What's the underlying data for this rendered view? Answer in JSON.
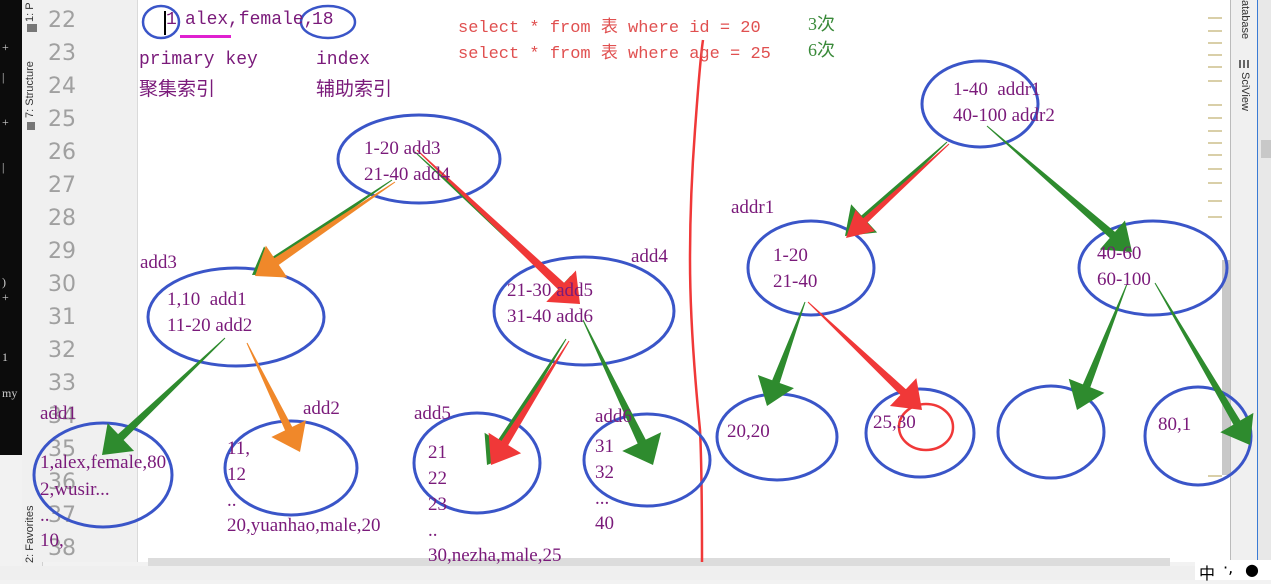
{
  "terminal": {
    "lines": [
      "+",
      "|",
      "+",
      "|",
      ")",
      "+",
      "1",
      "my"
    ]
  },
  "left_toolwindows": {
    "project": "1: P",
    "structure": "7: Structure",
    "favorites": "2: Favorites"
  },
  "right_toolwindows": {
    "database": "atabase",
    "sciview": "SciView"
  },
  "line_numbers": [
    "22",
    "23",
    "24",
    "25",
    "26",
    "27",
    "28",
    "29",
    "30",
    "31",
    "32",
    "33",
    "34",
    "35",
    "36",
    "37",
    "38"
  ],
  "editor": {
    "row_record": {
      "id": "1",
      "name": "alex",
      "rest": ",female,",
      "age": "18"
    },
    "labels": {
      "primary_key": "primary key",
      "clustered_index": "聚集索引",
      "index": "index",
      "secondary_index": "辅助索引"
    },
    "queries": [
      {
        "sql": "select * from 表 where id = 20",
        "count": "3次"
      },
      {
        "sql": "select * from 表 where age = 25",
        "count": "6次"
      }
    ]
  },
  "clustered_tree": {
    "root": {
      "line1": "1-20 add3",
      "line2": "21-40 add4"
    },
    "add3_label": "add3",
    "add3": {
      "line1": "1,10  add1",
      "line2": "11-20 add2"
    },
    "add4_label": "add4",
    "add4": {
      "line1": "21-30 add5",
      "line2": "31-40 add6"
    },
    "leaves": {
      "add1": {
        "label": "add1",
        "rows": [
          "1,alex,female,80",
          "2,wusir...",
          "..",
          "10,"
        ]
      },
      "add2": {
        "label": "add2",
        "rows": [
          "11,",
          "12",
          "..",
          "20,yuanhao,male,20"
        ]
      },
      "add5": {
        "label": "add5",
        "rows": [
          "21",
          "22",
          "23",
          "..",
          "30,nezha,male,25"
        ]
      },
      "add6": {
        "label": "add6",
        "rows": [
          "31",
          "32",
          "...",
          "40"
        ]
      }
    }
  },
  "secondary_tree": {
    "root": {
      "line1": "1-40  addr1",
      "line2": "40-100 addr2"
    },
    "addr1_label": "addr1",
    "left": {
      "line1": "1-20",
      "line2": "21-40"
    },
    "right": {
      "line1": "40-60",
      "line2": "60-100"
    },
    "leaves": [
      "20,20",
      "25,30",
      "",
      "80,1"
    ]
  },
  "ime": {
    "mode": "中",
    "punct": "·,",
    "moon": "●"
  },
  "colors": {
    "ellipse": "#3a55c8",
    "arrow_green": "#2e8b2e",
    "arrow_red": "#f03838",
    "arrow_orange": "#f0882a",
    "text_purple": "#7a1a7a",
    "sql_red": "#e05050"
  }
}
